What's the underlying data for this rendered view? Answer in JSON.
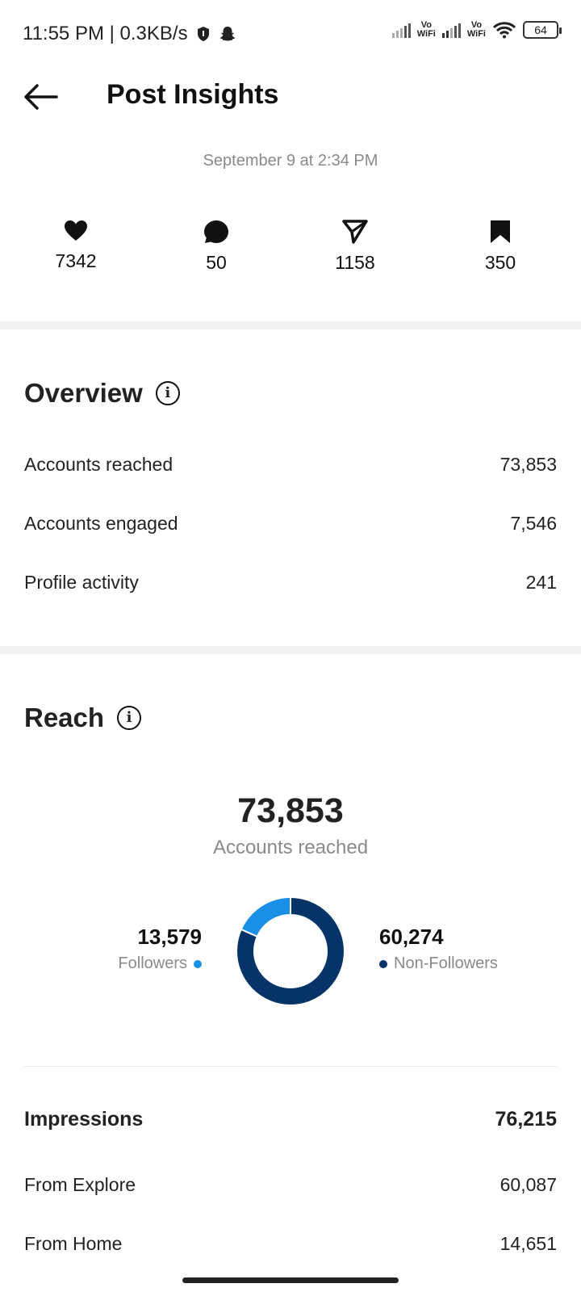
{
  "status_bar": {
    "time": "11:55 PM | 0.3KB/s",
    "vowifi_1": "Vo\nWiFi",
    "vowifi_2": "Vo\nWiFi",
    "battery": "64"
  },
  "header": {
    "title": "Post Insights"
  },
  "post_date": "September 9 at 2:34 PM",
  "stats": {
    "likes": "7342",
    "comments": "50",
    "shares": "1158",
    "saves": "350"
  },
  "overview": {
    "title": "Overview",
    "rows": [
      {
        "label": "Accounts reached",
        "value": "73,853"
      },
      {
        "label": "Accounts engaged",
        "value": "7,546"
      },
      {
        "label": "Profile activity",
        "value": "241"
      }
    ]
  },
  "reach": {
    "title": "Reach",
    "total": "73,853",
    "total_label": "Accounts reached",
    "followers_value": "13,579",
    "followers_label": "Followers",
    "non_followers_value": "60,274",
    "non_followers_label": "Non-Followers",
    "followers_color": "#1a8fe8",
    "non_followers_color": "#063468"
  },
  "chart_data": {
    "type": "pie",
    "categories": [
      "Followers",
      "Non-Followers"
    ],
    "values": [
      13579,
      60274
    ],
    "colors": [
      "#1a8fe8",
      "#063468"
    ]
  },
  "impressions": {
    "label": "Impressions",
    "value": "76,215",
    "rows": [
      {
        "label": "From Explore",
        "value": "60,087"
      },
      {
        "label": "From Home",
        "value": "14,651"
      }
    ]
  }
}
